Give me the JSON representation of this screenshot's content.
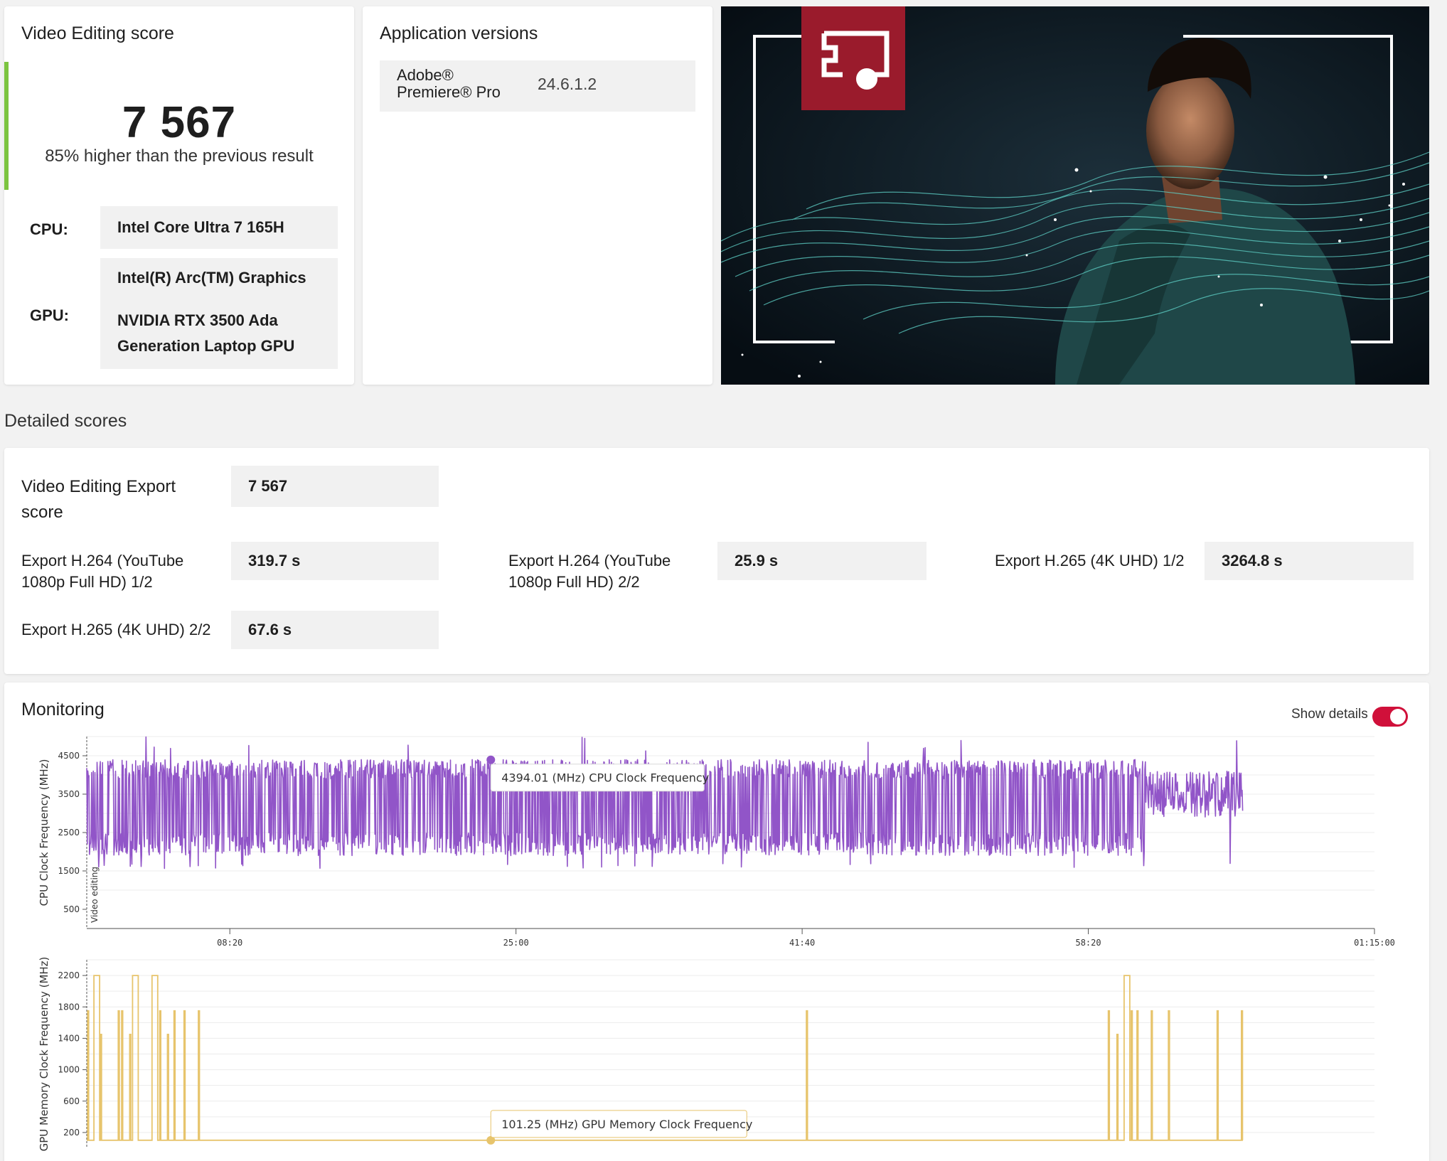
{
  "score_card": {
    "title": "Video Editing score",
    "score": "7 567",
    "comparison": "85% higher than the previous result",
    "cpu_label": "CPU:",
    "cpu_value": "Intel Core Ultra 7 165H",
    "gpu_label": "GPU:",
    "gpu_values": [
      "Intel(R) Arc(TM) Graphics",
      "NVIDIA RTX 3500 Ada",
      "Generation Laptop GPU"
    ]
  },
  "app_card": {
    "title": "Application versions",
    "app_name_line1": "Adobe®",
    "app_name_line2": "Premiere® Pro",
    "app_version": "24.6.1.2"
  },
  "hero": {
    "icon": "presentation-screen-icon",
    "accent_color": "#9a1b2c"
  },
  "detailed": {
    "section_title": "Detailed scores",
    "export_label_line1": "Video Editing Export",
    "export_label_line2": "score",
    "export_value": "7 567",
    "items": [
      {
        "line1": "Export H.264 (YouTube",
        "line2": "1080p Full HD) 1/2",
        "value": "319.7 s"
      },
      {
        "line1": "Export H.264 (YouTube",
        "line2": "1080p Full HD) 2/2",
        "value": "25.9 s"
      },
      {
        "line1": "Export H.265 (4K UHD) 1/2",
        "line2": "",
        "value": "3264.8 s"
      },
      {
        "line1": "Export H.265 (4K UHD) 2/2",
        "line2": "",
        "value": "67.6 s"
      }
    ]
  },
  "monitoring": {
    "title": "Monitoring",
    "show_details_label": "Show details",
    "show_details_on": true,
    "toggle_color": "#d0103a"
  },
  "chart_data": [
    {
      "type": "line",
      "ylabel": "CPU Clock Frequency (MHz)",
      "series": [
        {
          "name": "CPU Clock Frequency",
          "color": "#9155c8"
        }
      ],
      "band_label": "Video editing",
      "x_ticks": [
        "08:20",
        "25:00",
        "41:40",
        "58:20",
        "01:15:00"
      ],
      "x_tick_seconds": [
        500,
        1500,
        2500,
        3500,
        4500
      ],
      "xlim_seconds": [
        0,
        4500
      ],
      "data_end_seconds": 4040,
      "y_ticks": [
        4500,
        3500,
        2500,
        1500,
        500
      ],
      "ylim": [
        0,
        5000
      ],
      "typical_range": [
        1900,
        4400
      ],
      "min_dips": 1550,
      "max_spikes": 5000,
      "tooltip": {
        "text": "4394.01 (MHz) CPU Clock Frequency",
        "x_seconds": 1412,
        "y": 4394.01
      },
      "grid": true
    },
    {
      "type": "line",
      "ylabel": "GPU Memory Clock Frequency (MHz)",
      "series": [
        {
          "name": "GPU Memory Clock Frequency",
          "color": "#e7c46c"
        }
      ],
      "x_ticks": [],
      "xlim_seconds": [
        0,
        4500
      ],
      "data_end_seconds": 4040,
      "y_ticks": [
        2200,
        1800,
        1400,
        1000,
        600,
        200
      ],
      "ylim": [
        0,
        2400
      ],
      "baseline": 101.25,
      "tooltip": {
        "text": "101.25 (MHz) GPU Memory Clock Frequency",
        "x_seconds": 1412,
        "y": 101.25
      },
      "events": [
        {
          "t": 3,
          "v": 1750
        },
        {
          "t": 25,
          "v": 2200
        },
        {
          "t": 48,
          "v": 1450
        },
        {
          "t": 110,
          "v": 1750
        },
        {
          "t": 122,
          "v": 1750
        },
        {
          "t": 150,
          "v": 1450
        },
        {
          "t": 160,
          "v": 2200
        },
        {
          "t": 228,
          "v": 2200
        },
        {
          "t": 255,
          "v": 1750
        },
        {
          "t": 282,
          "v": 1450
        },
        {
          "t": 305,
          "v": 1750
        },
        {
          "t": 340,
          "v": 1750
        },
        {
          "t": 390,
          "v": 1750
        },
        {
          "t": 2515,
          "v": 1750
        },
        {
          "t": 3570,
          "v": 1750
        },
        {
          "t": 3600,
          "v": 1450
        },
        {
          "t": 3625,
          "v": 2200
        },
        {
          "t": 3650,
          "v": 1750
        },
        {
          "t": 3670,
          "v": 1750
        },
        {
          "t": 3720,
          "v": 1750
        },
        {
          "t": 3780,
          "v": 1750
        },
        {
          "t": 3950,
          "v": 1750
        },
        {
          "t": 4035,
          "v": 1750
        }
      ],
      "grid": true
    }
  ]
}
